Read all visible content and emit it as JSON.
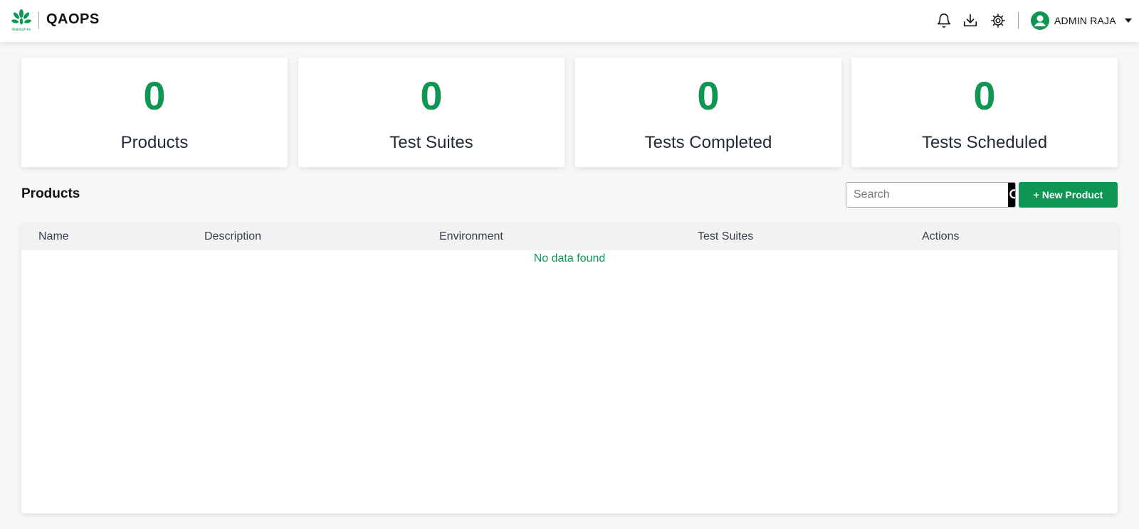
{
  "header": {
    "app_title": "QAOPS",
    "logo_text": "WakingTree",
    "user_name": "ADMIN RAJA",
    "icons": [
      "bell-icon",
      "download-icon",
      "gear-icon",
      "user-avatar-icon",
      "caret-down-icon"
    ]
  },
  "stats": [
    {
      "value": "0",
      "label": "Products"
    },
    {
      "value": "0",
      "label": "Test Suites"
    },
    {
      "value": "0",
      "label": "Tests Completed"
    },
    {
      "value": "0",
      "label": "Tests Scheduled"
    }
  ],
  "products": {
    "title": "Products",
    "search_placeholder": "Search",
    "new_button": "+ New Product",
    "columns": [
      "Name",
      "Description",
      "Environment",
      "Test Suites",
      "Actions"
    ],
    "empty_text": "No data found"
  },
  "colors": {
    "accent": "#0f9653",
    "topbar_bg": "#ffffff",
    "page_bg": "#f7f7f7",
    "header_row_bg": "#f2f2f2"
  }
}
